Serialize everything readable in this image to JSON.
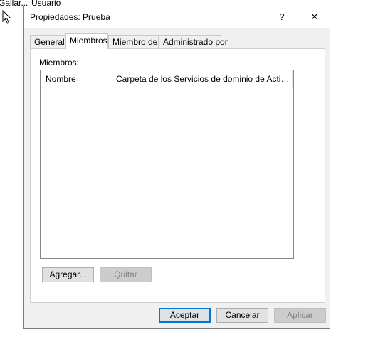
{
  "background": {
    "items": [
      "Gallar...",
      "Usuario"
    ]
  },
  "dialog": {
    "title": "Propiedades: Prueba",
    "help_label": "?",
    "close_label": "✕",
    "tabs": [
      {
        "label": "General",
        "active": false
      },
      {
        "label": "Miembros",
        "active": true
      },
      {
        "label": "Miembro de",
        "active": false
      },
      {
        "label": "Administrado por",
        "active": false
      }
    ],
    "members_label": "Miembros:",
    "list_columns": [
      "Nombre",
      "Carpeta de los Servicios de dominio de Active Dir..."
    ],
    "add_label": "Agregar...",
    "remove_label": "Quitar",
    "ok_label": "Aceptar",
    "cancel_label": "Cancelar",
    "apply_label": "Aplicar"
  },
  "colors": {
    "accent": "#0078d7",
    "dialog_bg": "#f0f0f0"
  }
}
